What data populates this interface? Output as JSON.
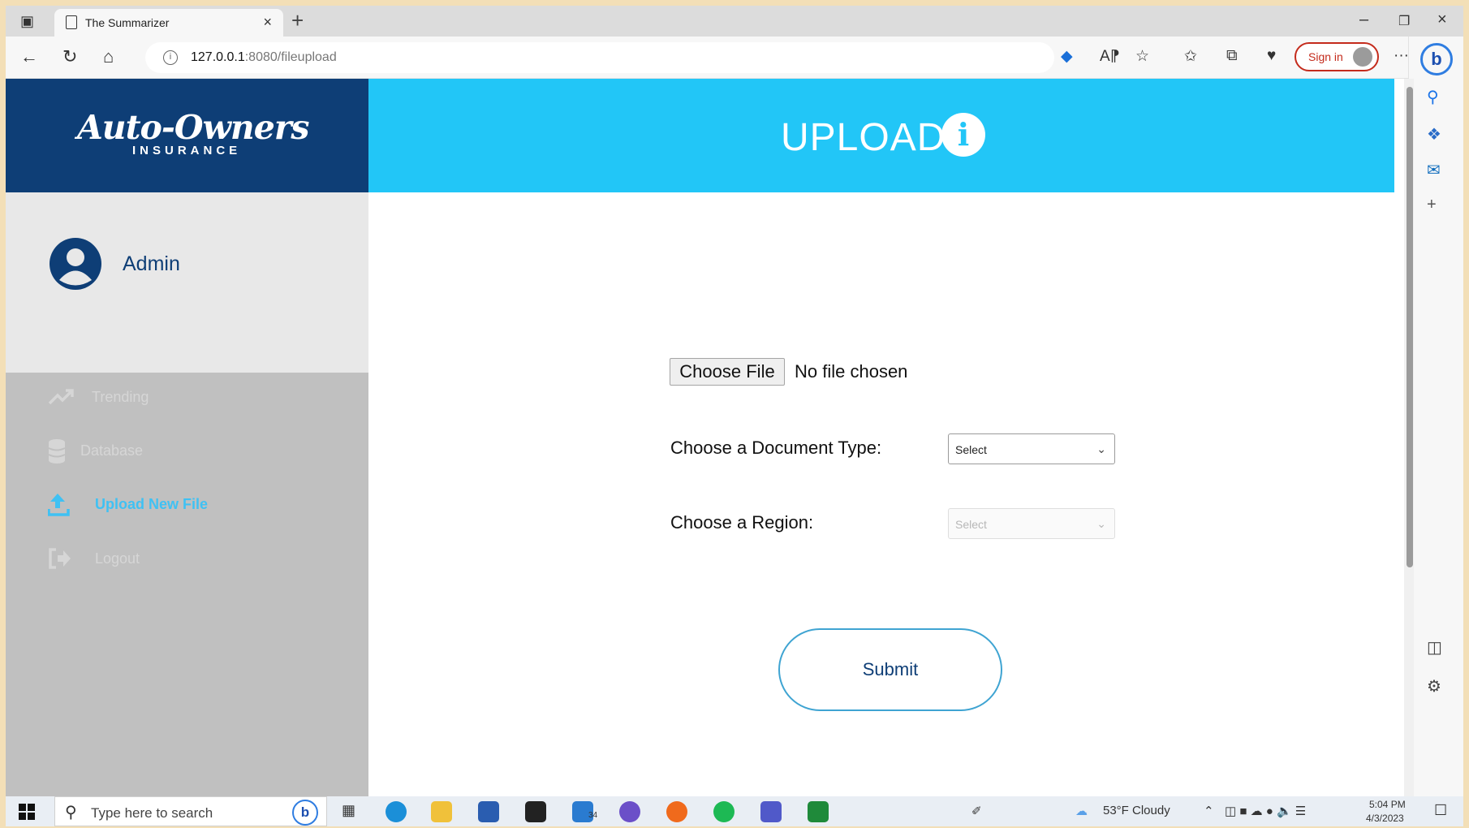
{
  "browser": {
    "tab_title": "The Summarizer",
    "url_host": "127.0.0.1",
    "url_rest": ":8080/fileupload",
    "sign_in": "Sign in",
    "more": "···"
  },
  "sidebar": {
    "logo_main": "Auto-Owners",
    "logo_sub": "INSURANCE",
    "user_name": "Admin",
    "nav_items": [
      {
        "label": "Trending",
        "icon": "trending-icon",
        "active": false
      },
      {
        "label": "Database",
        "icon": "database-icon",
        "active": false
      },
      {
        "label": "Upload New File",
        "icon": "upload-icon",
        "active": true
      },
      {
        "label": "Logout",
        "icon": "logout-icon",
        "active": false
      }
    ]
  },
  "header": {
    "title": "UPLOAD",
    "info_glyph": "i"
  },
  "form": {
    "choose_file_label": "Choose File",
    "no_file_text": "No file chosen",
    "doc_type_label": "Choose a Document Type:",
    "doc_type_value": "Select",
    "region_label": "Choose a Region:",
    "region_value": "Select",
    "submit_label": "Submit"
  },
  "taskbar": {
    "search_placeholder": "Type here to search",
    "mail_badge": "34",
    "weather": "53°F  Cloudy",
    "time": "5:04 PM",
    "date": "4/3/2023"
  },
  "colors": {
    "navy": "#0e3e76",
    "cyan": "#22c6f7",
    "active_nav": "#3fc1f3"
  }
}
